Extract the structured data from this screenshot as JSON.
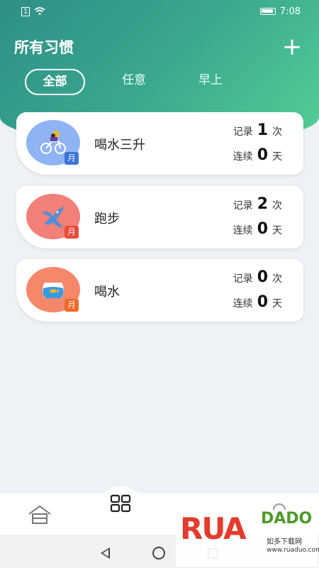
{
  "status_bar": {
    "left_indicator": "1",
    "time": "7:08"
  },
  "header": {
    "title": "所有习惯",
    "add_label": "+"
  },
  "tabs": [
    {
      "label": "全部",
      "active": true
    },
    {
      "label": "任意",
      "active": false
    },
    {
      "label": "早上",
      "active": false
    }
  ],
  "habits": [
    {
      "name": "喝水三升",
      "icon": "cyclist-icon",
      "badge": "月",
      "record_label": "记录",
      "record_count": "1",
      "record_unit": "次",
      "streak_label": "连续",
      "streak_count": "0",
      "streak_unit": "天",
      "color": "#8fb4f3"
    },
    {
      "name": "跑步",
      "icon": "bird-icon",
      "badge": "月",
      "record_label": "记录",
      "record_count": "2",
      "record_unit": "次",
      "streak_label": "连续",
      "streak_count": "0",
      "streak_unit": "天",
      "color": "#f27f78"
    },
    {
      "name": "喝水",
      "icon": "fishbowl-icon",
      "badge": "月",
      "record_label": "记录",
      "record_count": "0",
      "record_unit": "次",
      "streak_label": "连续",
      "streak_count": "0",
      "streak_unit": "天",
      "color": "#f5876b"
    }
  ],
  "bottom_nav": {
    "items": [
      "home-icon",
      "grid-icon",
      "profile-icon"
    ]
  },
  "watermark": {
    "logo": "RUANDADO",
    "cn": "如多下载网",
    "url": "www.ruaduo.com"
  }
}
